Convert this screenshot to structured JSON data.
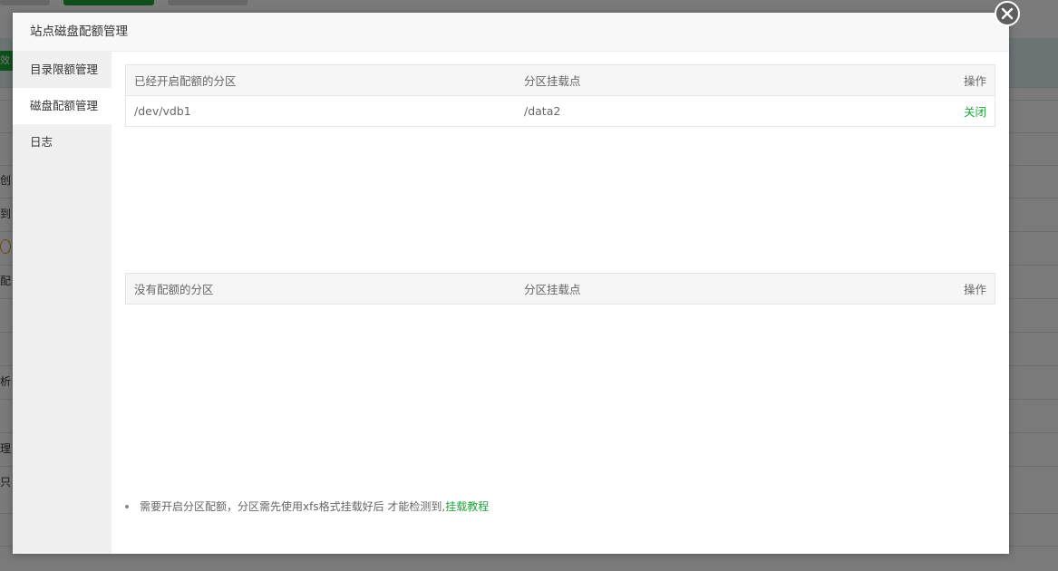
{
  "background": {
    "fragments": [
      "效",
      "创",
      "到",
      "配",
      "析",
      "理",
      "只"
    ]
  },
  "modal": {
    "title": "站点磁盘配额管理",
    "sidebar": {
      "items": [
        {
          "label": "目录限额管理",
          "active": false
        },
        {
          "label": "磁盘配额管理",
          "active": true
        },
        {
          "label": "日志",
          "active": false
        }
      ]
    },
    "enabled_table": {
      "headers": [
        "已经开启配额的分区",
        "分区挂载点",
        "操作"
      ],
      "rows": [
        {
          "partition": "/dev/vdb1",
          "mount": "/data2",
          "action": "关闭"
        }
      ]
    },
    "disabled_table": {
      "headers": [
        "没有配额的分区",
        "分区挂载点",
        "操作"
      ],
      "rows": []
    },
    "note": {
      "text": "需要开启分区配额，分区需先使用xfs格式挂载好后 才能检测到,",
      "link": "挂载教程"
    }
  },
  "colors": {
    "accent": "#20a53a",
    "close_button": "#5e5e5e"
  }
}
